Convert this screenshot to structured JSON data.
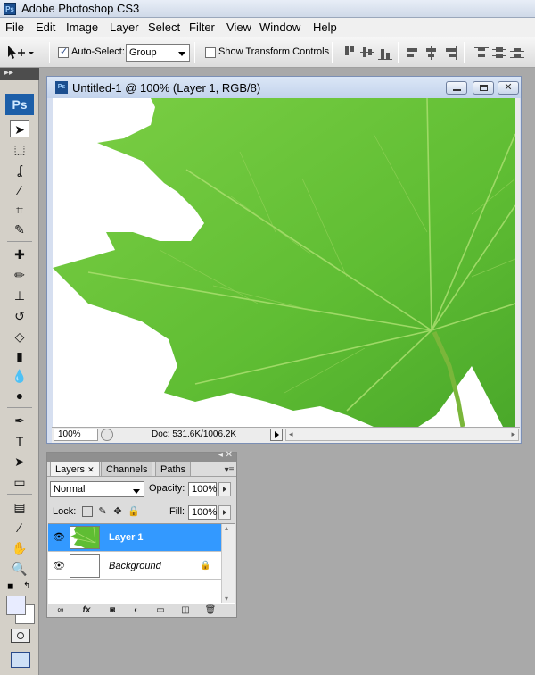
{
  "app": {
    "title": "Adobe Photoshop CS3",
    "icon": "photoshop-icon"
  },
  "menu": [
    "File",
    "Edit",
    "Image",
    "Layer",
    "Select",
    "Filter",
    "View",
    "Window",
    "Help"
  ],
  "options": {
    "auto_select_label": "Auto-Select:",
    "auto_select_checked": true,
    "auto_select_value": "Group",
    "show_transform_label": "Show Transform Controls",
    "show_transform_checked": false
  },
  "toolbox": {
    "logo": "Ps"
  },
  "document": {
    "title": "Untitled-1 @ 100% (Layer 1, RGB/8)",
    "zoom": "100%",
    "doc_info": "Doc: 531.6K/1006.2K"
  },
  "layers_panel": {
    "tabs": [
      "Layers",
      "Channels",
      "Paths"
    ],
    "active_tab": "Layers",
    "blend_mode": "Normal",
    "opacity_label": "Opacity:",
    "opacity": "100%",
    "lock_label": "Lock:",
    "fill_label": "Fill:",
    "fill": "100%",
    "layers": [
      {
        "name": "Layer 1",
        "selected": true,
        "visible": true
      },
      {
        "name": "Background",
        "selected": false,
        "visible": true,
        "locked": true
      }
    ]
  },
  "colors": {
    "selected_layer": "#3399ff",
    "leaf_green": "#5cbf35",
    "leaf_vein": "#a6dd6c",
    "workspace": "#a9a9a9"
  }
}
